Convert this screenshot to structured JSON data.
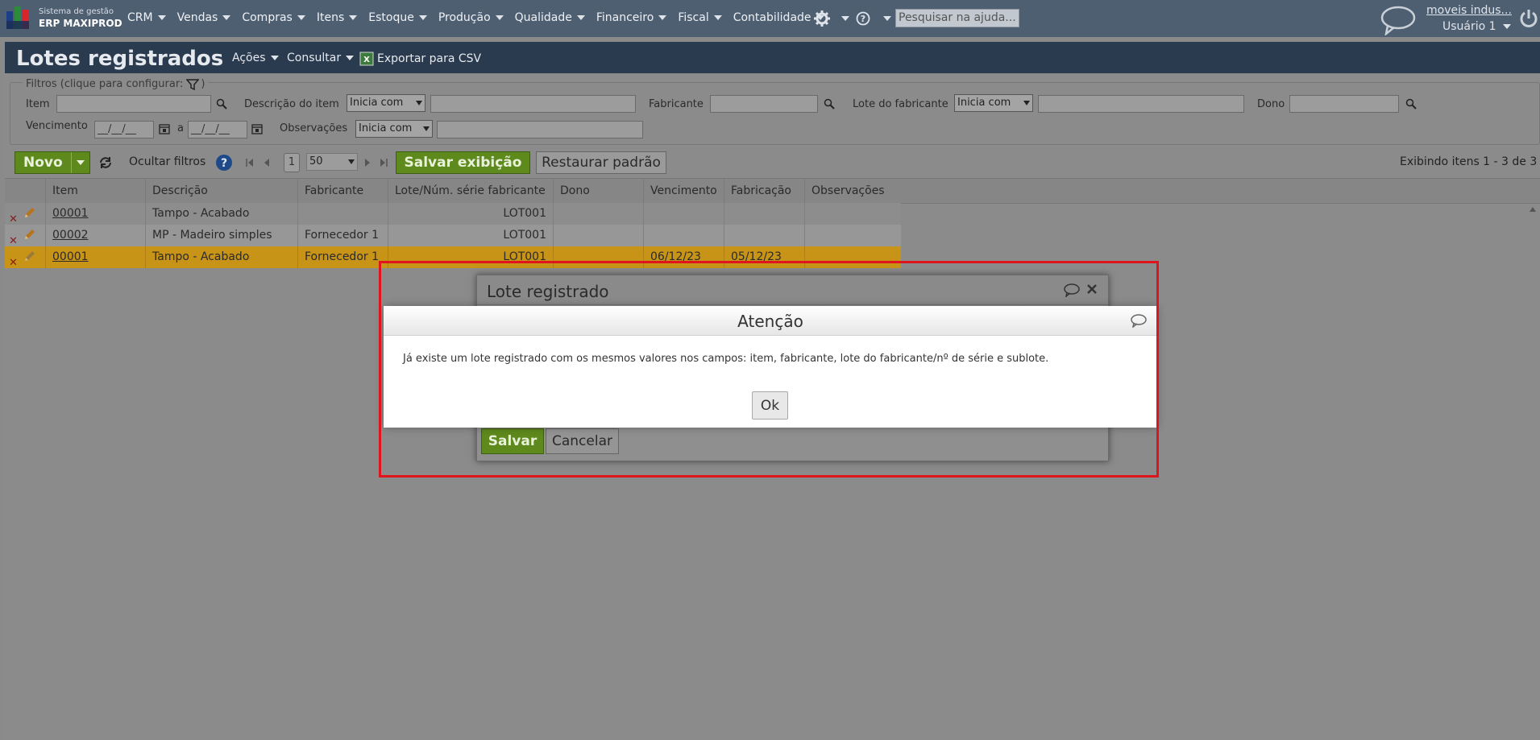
{
  "app": {
    "logo_line1": "Sistema de gestão",
    "logo_line2": "ERP MAXIPROD",
    "menu": [
      "CRM",
      "Vendas",
      "Compras",
      "Itens",
      "Estoque",
      "Produção",
      "Qualidade",
      "Financeiro",
      "Fiscal",
      "Contabilidade"
    ],
    "help_placeholder": "Pesquisar na ajuda...",
    "company_link": "moveis indus...",
    "user_name": "Usuário 1"
  },
  "page": {
    "title": "Lotes registrados",
    "actions_label": "Ações",
    "query_label": "Consultar",
    "export_label": "Exportar para CSV"
  },
  "filters": {
    "legend": "Filtros (clique para configurar:",
    "legend_close": ")",
    "item_label": "Item",
    "desc_label": "Descrição do item",
    "desc_mode": "Inicia com",
    "maker_label": "Fabricante",
    "maker_lot_label": "Lote do fabricante",
    "maker_lot_mode": "Inicia com",
    "owner_label": "Dono",
    "due_label": "Vencimento",
    "date_from": "__/__/__",
    "date_sep": "a",
    "date_to": "__/__/__",
    "notes_label": "Observações",
    "notes_mode": "Inicia com"
  },
  "toolbar": {
    "new_label": "Novo",
    "hide_filters": "Ocultar filtros",
    "page_number": "1",
    "page_size": "50",
    "save_view": "Salvar exibição",
    "restore_default": "Restaurar padrão",
    "showing": "Exibindo itens 1 - 3 de 3"
  },
  "grid": {
    "columns": [
      "Item",
      "Descrição",
      "Fabricante",
      "Lote/Núm. série fabricante",
      "Dono",
      "Vencimento",
      "Fabricação",
      "Observações"
    ],
    "rows": [
      {
        "item": "00001",
        "desc": "Tampo - Acabado",
        "maker": "",
        "lot": "LOT001",
        "owner": "",
        "due": "",
        "made": "",
        "notes": ""
      },
      {
        "item": "00002",
        "desc": "MP - Madeiro simples",
        "maker": "Fornecedor 1",
        "lot": "LOT001",
        "owner": "",
        "due": "",
        "made": "",
        "notes": ""
      },
      {
        "item": "00001",
        "desc": "Tampo - Acabado",
        "maker": "Fornecedor 1",
        "lot": "LOT001",
        "owner": "",
        "due": "06/12/23",
        "made": "05/12/23",
        "notes": ""
      }
    ]
  },
  "dialog": {
    "title": "Lote registrado",
    "save": "Salvar",
    "cancel": "Cancelar"
  },
  "alert": {
    "title": "Atenção",
    "message": "Já existe um lote registrado com os mesmos valores nos campos: item, fabricante, lote do fabricante/nº de série e sublote.",
    "ok": "Ok"
  },
  "colors": {
    "highlight_row": "#c89417",
    "annotation": "#e0141c"
  }
}
